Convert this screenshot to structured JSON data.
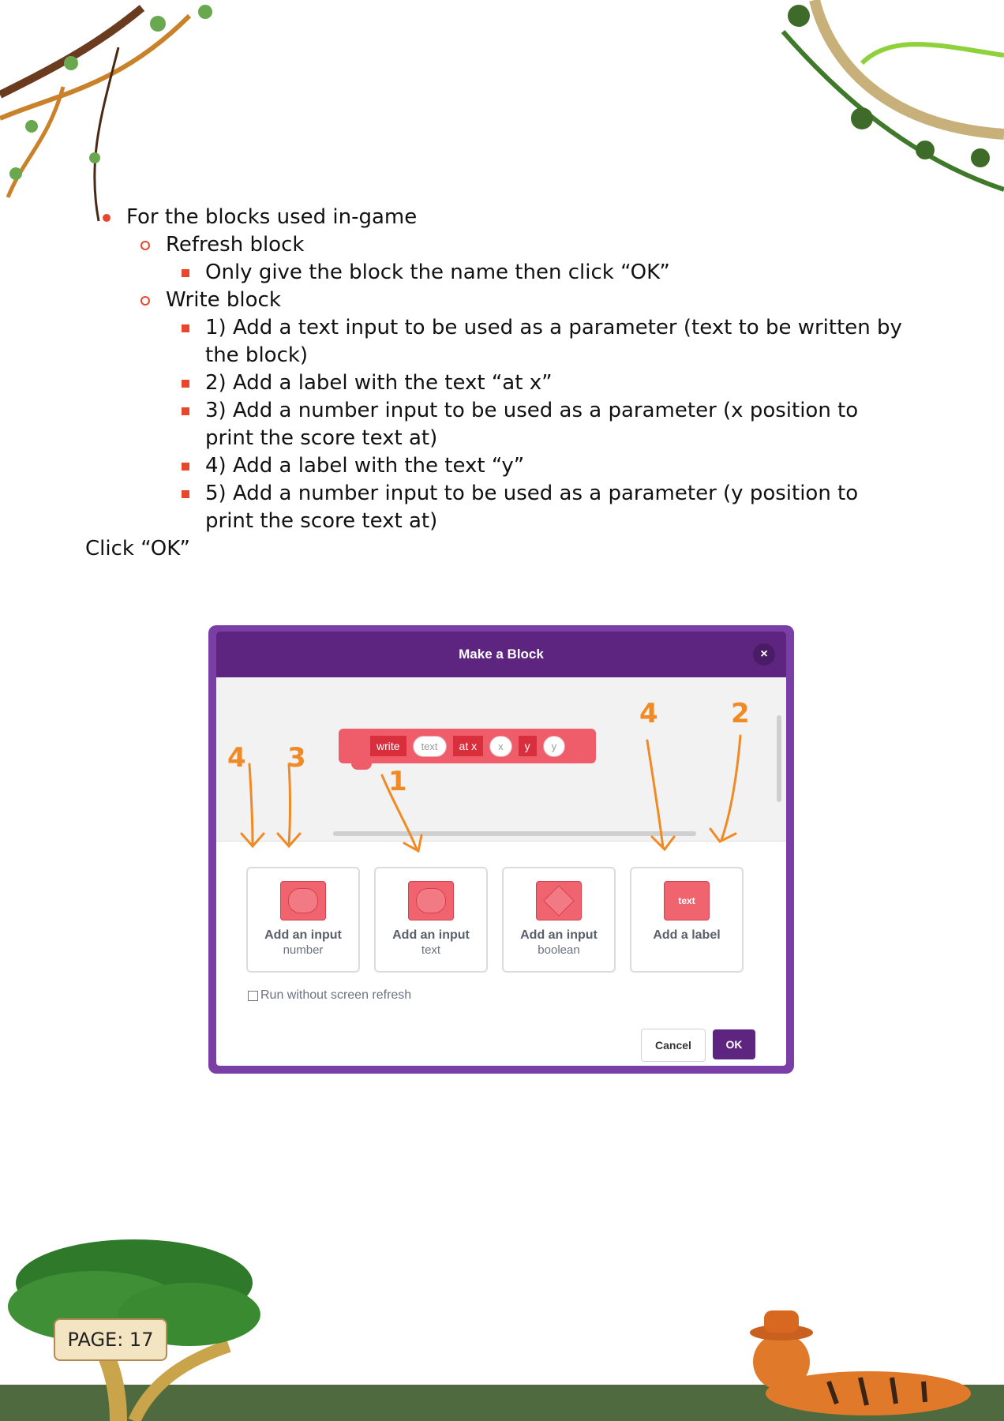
{
  "content": {
    "bullet_main": "For the blocks used in-game",
    "refresh_block": "Refresh block",
    "refresh_step": "Only give the block the name then click “OK”",
    "write_block": "Write block",
    "write_steps": [
      "1) Add a text input to be used as a parameter (text to be written by the block)",
      "2) Add a label with the text “at x”",
      "3) Add a number input to be used as a parameter (x position to print the score text at)",
      "4) Add a label with the text “y”",
      "5) Add a number input to be used as a parameter (y position to print the score text at)"
    ],
    "closing": "Click “OK”"
  },
  "dialog": {
    "title": "Make a Block",
    "close_glyph": "×",
    "block": {
      "segments": [
        "write",
        "text",
        "at x",
        "x",
        "y",
        "y"
      ]
    },
    "annotations": [
      "4",
      "3",
      "1",
      "4",
      "2"
    ],
    "options": [
      {
        "title": "Add an input",
        "sub": "number"
      },
      {
        "title": "Add an input",
        "sub": "text"
      },
      {
        "title": "Add an input",
        "sub": "boolean"
      },
      {
        "title": "Add a label",
        "icon_text": "text"
      }
    ],
    "refresh_label": "Run without screen refresh",
    "cancel": "Cancel",
    "ok": "OK"
  },
  "page_label": "PAGE: 17",
  "colors": {
    "bullet": "#e8472b",
    "dialog_header": "#5e2580",
    "block": "#ef5d6b",
    "annotation": "#f08a24",
    "ground": "#4f6a3f"
  }
}
